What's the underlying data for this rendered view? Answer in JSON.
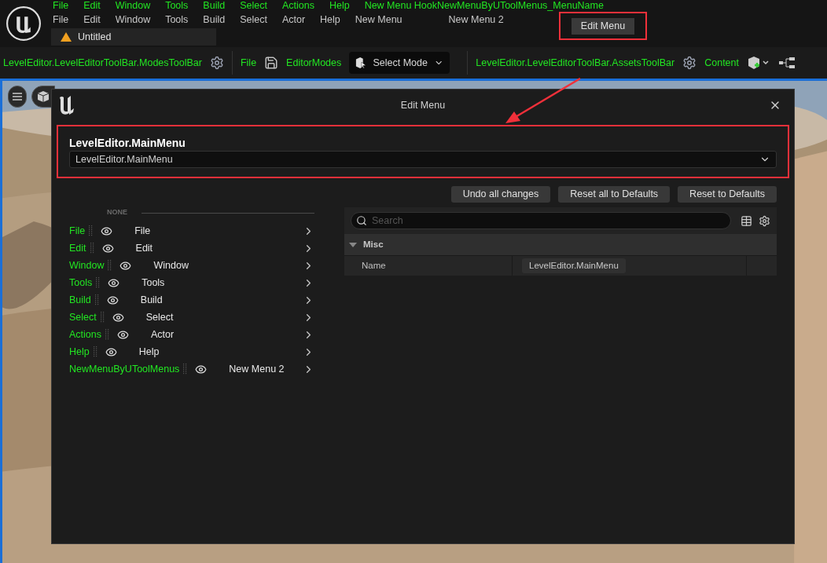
{
  "menu_bar": {
    "top_row": [
      "File",
      "Edit",
      "Window",
      "Tools",
      "Build",
      "Select",
      "Actions",
      "Help",
      "New Menu HookNewMenuByUToolMenus_MenuName"
    ],
    "bottom_row": [
      "File",
      "Edit",
      "Window",
      "Tools",
      "Build",
      "Select",
      "Actor",
      "Help",
      "New Menu",
      "New Menu 2"
    ],
    "edit_menu_button": "Edit Menu"
  },
  "document_tab": {
    "title": "Untitled"
  },
  "toolbar": {
    "modes_toolbar_name": "LevelEditor.LevelEditorToolBar.ModesToolBar",
    "file_label": "File",
    "editor_modes_label": "EditorModes",
    "select_mode": "Select Mode",
    "assets_toolbar_name": "LevelEditor.LevelEditorToolBar.AssetsToolBar",
    "content_label": "Content"
  },
  "dialog": {
    "title": "Edit Menu",
    "menu_name_label": "LevelEditor.MainMenu",
    "menu_name_value": "LevelEditor.MainMenu",
    "buttons": [
      "Undo all changes",
      "Reset all to Defaults",
      "Reset to Defaults"
    ],
    "section": "NONE",
    "entries": [
      {
        "name": "File",
        "label": "File",
        "visible": true
      },
      {
        "name": "Edit",
        "label": "Edit",
        "visible": true
      },
      {
        "name": "Window",
        "label": "Window",
        "visible": true
      },
      {
        "name": "Tools",
        "label": "Tools",
        "visible": true
      },
      {
        "name": "Build",
        "label": "Build",
        "visible": true
      },
      {
        "name": "Select",
        "label": "Select",
        "visible": true
      },
      {
        "name": "Actions",
        "label": "Actor",
        "visible": true
      },
      {
        "name": "Help",
        "label": "Help",
        "visible": true
      },
      {
        "name": "NewMenuByUToolMenus",
        "label": "New Menu 2",
        "visible": true
      }
    ],
    "search": {
      "placeholder": "Search"
    },
    "category": {
      "title": "Misc",
      "expanded": true,
      "properties": [
        {
          "name": "Name",
          "value": "LevelEditor.MainMenu"
        }
      ]
    }
  }
}
